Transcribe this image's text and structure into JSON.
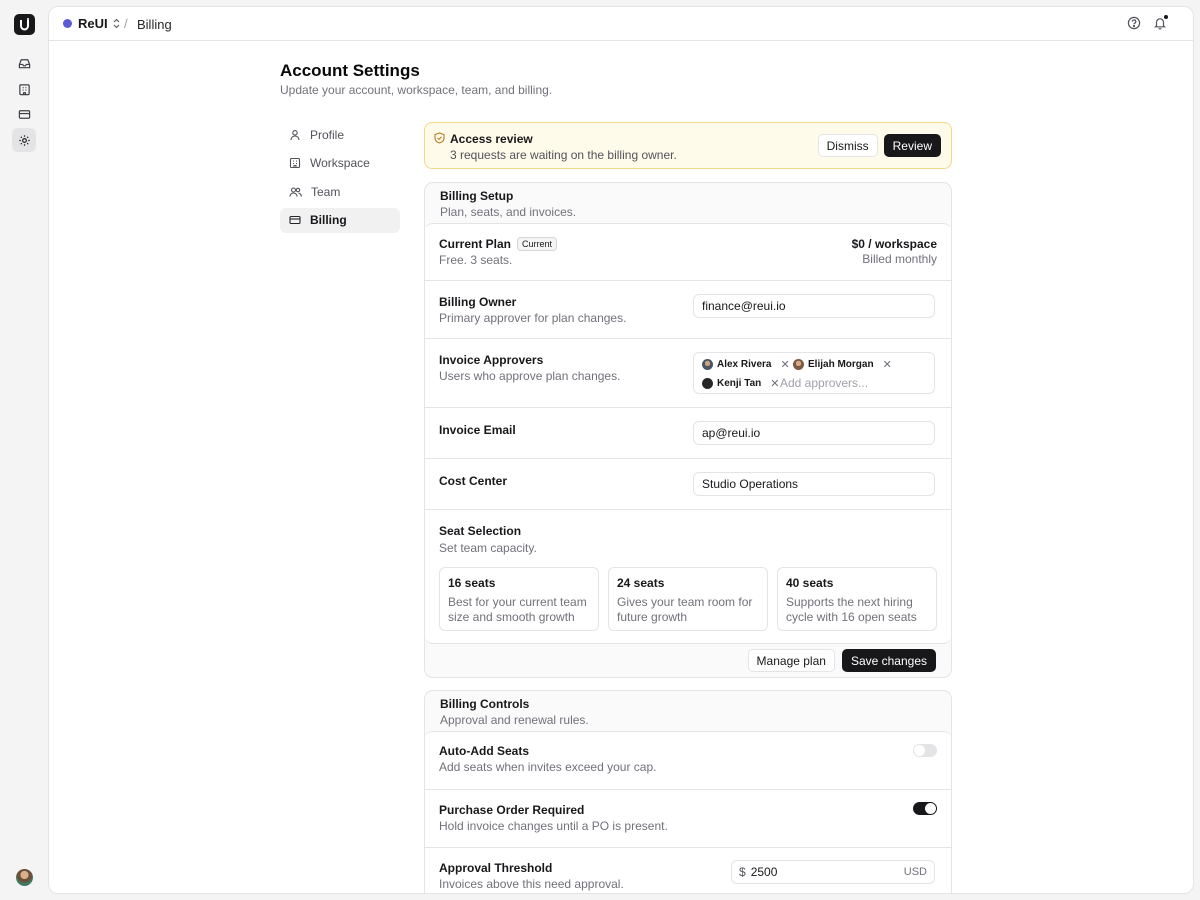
{
  "topbar": {
    "workspace_name": "ReUI",
    "breadcrumb_current": "Billing"
  },
  "page": {
    "title": "Account Settings",
    "subtitle": "Update your account, workspace, team, and billing."
  },
  "nav": {
    "items": [
      {
        "label": "Profile",
        "icon": "user-icon"
      },
      {
        "label": "Workspace",
        "icon": "building-icon"
      },
      {
        "label": "Team",
        "icon": "users-icon"
      },
      {
        "label": "Billing",
        "icon": "credit-card-icon",
        "active": true
      }
    ]
  },
  "alert": {
    "title": "Access review",
    "description": "3 requests are waiting on the billing owner.",
    "dismiss_label": "Dismiss",
    "review_label": "Review"
  },
  "billing_setup": {
    "title": "Billing Setup",
    "description": "Plan, seats, and invoices.",
    "current_plan": {
      "label": "Current Plan",
      "badge": "Current",
      "description": "Free. 3 seats.",
      "price": "$0 / workspace",
      "billing_cycle": "Billed monthly"
    },
    "billing_owner": {
      "label": "Billing Owner",
      "description": "Primary approver for plan changes.",
      "value": "finance@reui.io"
    },
    "invoice_approvers": {
      "label": "Invoice Approvers",
      "description": "Users who approve plan changes.",
      "approvers": [
        "Alex Rivera",
        "Elijah Morgan",
        "Kenji Tan"
      ],
      "placeholder": "Add approvers..."
    },
    "invoice_email": {
      "label": "Invoice Email",
      "value": "ap@reui.io"
    },
    "cost_center": {
      "label": "Cost Center",
      "value": "Studio Operations"
    },
    "seat_selection": {
      "label": "Seat Selection",
      "description": "Set team capacity.",
      "options": [
        {
          "title": "16 seats",
          "description": "Best for your current team size and smooth growth"
        },
        {
          "title": "24 seats",
          "description": "Gives your team room for future growth"
        },
        {
          "title": "40 seats",
          "description": "Supports the next hiring cycle with 16 open seats"
        }
      ]
    },
    "manage_plan_label": "Manage plan",
    "save_label": "Save changes"
  },
  "billing_controls": {
    "title": "Billing Controls",
    "description": "Approval and renewal rules.",
    "auto_add": {
      "label": "Auto-Add Seats",
      "description": "Add seats when invites exceed your cap.",
      "enabled": false
    },
    "purchase_order": {
      "label": "Purchase Order Required",
      "description": "Hold invoice changes until a PO is present.",
      "enabled": true
    },
    "approval_threshold": {
      "label": "Approval Threshold",
      "description": "Invoices above this need approval.",
      "currency_symbol": "$",
      "value": "2500",
      "unit": "USD"
    }
  },
  "colors": {
    "accent": "#18181b",
    "workspace_dot": "#5b5bd6",
    "alert_bg": "#fffbeb",
    "alert_border": "#f2d98a"
  }
}
